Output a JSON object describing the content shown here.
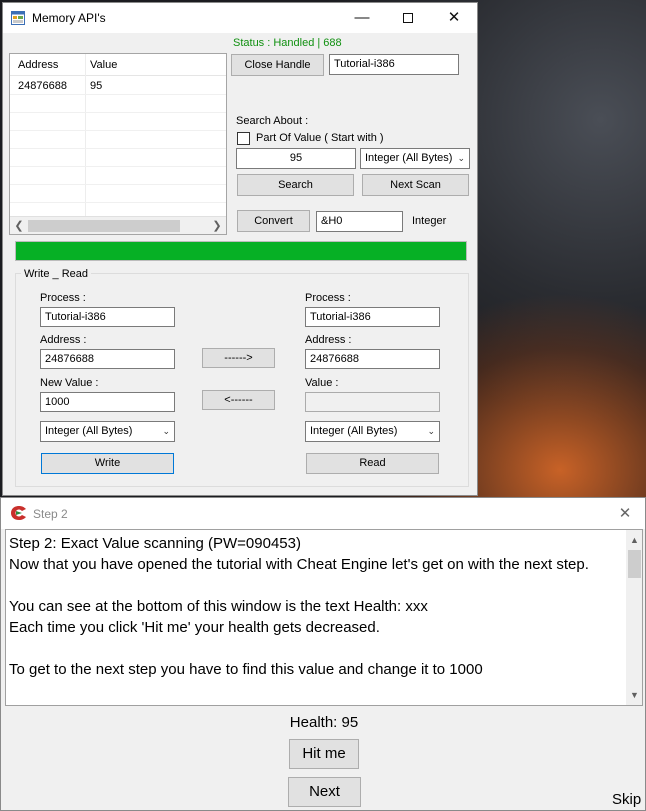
{
  "memory_window": {
    "title": "Memory API's",
    "status": "Status : Handled   |   688",
    "list": {
      "columns": [
        "Address",
        "Value"
      ],
      "rows": [
        {
          "address": "24876688",
          "value": "95"
        }
      ]
    },
    "close_handle_label": "Close Handle",
    "process_name": "Tutorial-i386",
    "search_about_label": "Search About :",
    "part_of_value_label": "Part Of Value ( Start with )",
    "part_of_value_checked": false,
    "search_value": "95",
    "search_type": "Integer (All Bytes)",
    "search_label": "Search",
    "next_scan_label": "Next Scan",
    "convert_label": "Convert",
    "convert_value": "&H0",
    "convert_type_label": "Integer",
    "progress_percent": 100,
    "progress_color": "#06b025",
    "status_color": "#109010",
    "write_read": {
      "title": "Write _ Read",
      "left": {
        "process_label": "Process :",
        "process_value": "Tutorial-i386",
        "address_label": "Address :",
        "address_value": "24876688",
        "new_value_label": "New Value :",
        "new_value": "1000",
        "type": "Integer (All Bytes)",
        "write_label": "Write"
      },
      "right": {
        "process_label": "Process :",
        "process_value": "Tutorial-i386",
        "address_label": "Address :",
        "address_value": "24876688",
        "value_label": "Value :",
        "value": "",
        "type": "Integer (All Bytes)",
        "read_label": "Read"
      },
      "copy_right_label": "------>",
      "copy_left_label": "<------"
    }
  },
  "step_window": {
    "title": "Step 2",
    "lines": [
      "Step 2: Exact Value scanning (PW=090453)",
      "Now that you have opened the tutorial with Cheat Engine let's get on with the next step.",
      "",
      "You can see at the bottom of this window is the text Health: xxx",
      "Each time you click 'Hit me'  your health gets decreased.",
      "",
      "To get to the next step you have to find this value and change it to 1000"
    ],
    "health_text": "Health: 95",
    "hit_me_label": "Hit me",
    "next_label": "Next",
    "skip_label": "Skip"
  }
}
